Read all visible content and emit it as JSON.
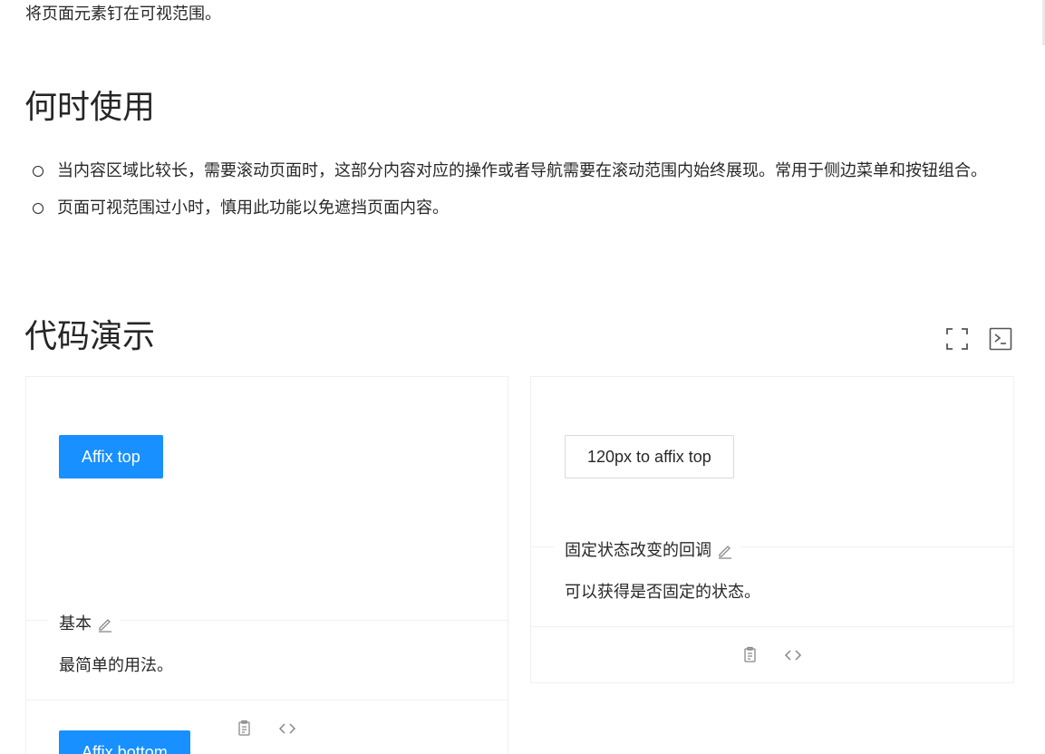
{
  "intro": "将页面元素钉在可视范围。",
  "when_to_use": {
    "title": "何时使用",
    "items": [
      "当内容区域比较长，需要滚动页面时，这部分内容对应的操作或者导航需要在滚动范围内始终展现。常用于侧边菜单和按钮组合。",
      "页面可视范围过小时，慎用此功能以免遮挡页面内容。"
    ]
  },
  "demos": {
    "title": "代码演示",
    "toolbar": {
      "expand_icon": "expand-icon",
      "code_icon": "terminal-icon"
    },
    "basic": {
      "top_button": "Affix top",
      "bottom_button": "Affix bottom",
      "title": "基本",
      "description": "最简单的用法。"
    },
    "callback": {
      "button": "120px to affix top",
      "title": "固定状态改变的回调",
      "description": "可以获得是否固定的状态。"
    }
  },
  "colors": {
    "primary": "#1890ff",
    "border": "#f0f0f0",
    "text": "#262626"
  }
}
